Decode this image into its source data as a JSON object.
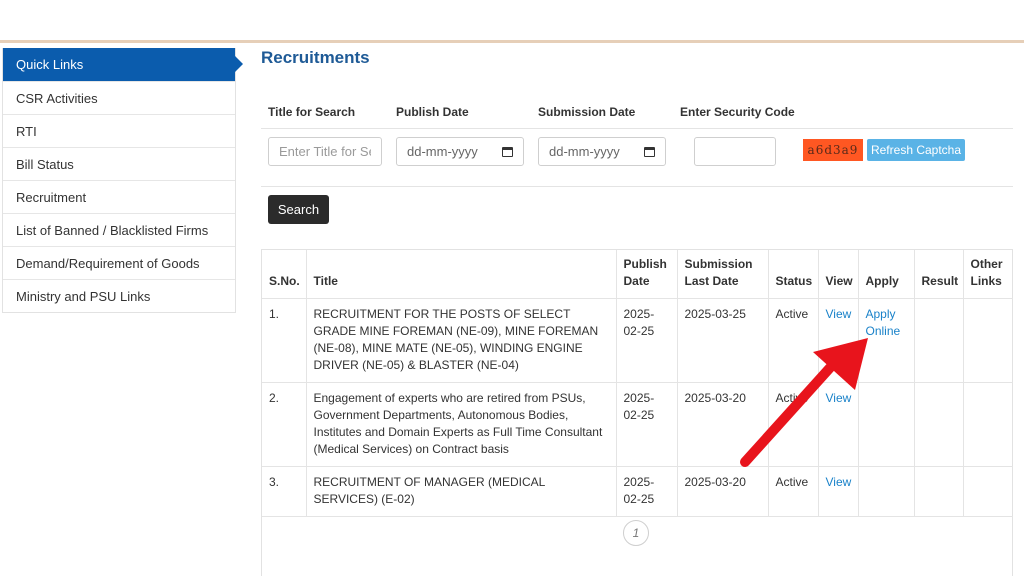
{
  "sidebar": {
    "items": [
      {
        "label": "Quick Links",
        "active": true
      },
      {
        "label": "CSR Activities"
      },
      {
        "label": "RTI"
      },
      {
        "label": "Bill Status"
      },
      {
        "label": "Recruitment"
      },
      {
        "label": "List of Banned / Blacklisted Firms"
      },
      {
        "label": "Demand/Requirement of Goods"
      },
      {
        "label": "Ministry and PSU Links"
      }
    ]
  },
  "main": {
    "title": "Recruitments",
    "form": {
      "labels": {
        "title_search": "Title for Search",
        "publish_date": "Publish Date",
        "submission_date": "Submission Date",
        "security_code": "Enter Security Code"
      },
      "title_placeholder": "Enter Title for Se",
      "publish_date_value": "dd-mm-yyyy",
      "submission_date_value": "dd-mm-yyyy",
      "captcha_text": "a6d3a9",
      "refresh_label": "Refresh Captcha",
      "search_label": "Search"
    },
    "table": {
      "headers": {
        "sno": "S.No.",
        "title": "Title",
        "publish": "Publish Date",
        "submission": "Submission Last Date",
        "status": "Status",
        "view": "View",
        "apply": "Apply",
        "result": "Result",
        "other": "Other Links"
      },
      "rows": [
        {
          "sno": "1.",
          "title": "RECRUITMENT FOR THE POSTS OF SELECT GRADE MINE FOREMAN (NE-09), MINE FOREMAN (NE-08), MINE MATE (NE-05), WINDING ENGINE DRIVER (NE-05) & BLASTER (NE-04)",
          "publish": "2025-02-25",
          "submission": "2025-03-25",
          "status": "Active",
          "view": "View",
          "apply": "Apply Online"
        },
        {
          "sno": "2.",
          "title": "Engagement of experts who are retired from PSUs, Government Departments, Autonomous Bodies, Institutes and Domain Experts as Full Time Consultant (Medical Services) on Contract basis",
          "publish": "2025-02-25",
          "submission": "2025-03-20",
          "status": "Active",
          "view": "View",
          "apply": ""
        },
        {
          "sno": "3.",
          "title": "RECRUITMENT OF MANAGER (MEDICAL SERVICES) (E-02)",
          "publish": "2025-02-25",
          "submission": "2025-03-20",
          "status": "Active",
          "view": "View",
          "apply": ""
        }
      ]
    },
    "pagination": {
      "current": "1"
    }
  },
  "colors": {
    "brand_blue": "#0b5cad",
    "title_blue": "#1e5a96",
    "link_blue": "#1a82c9",
    "captcha_bg": "#ff5722",
    "refresh_bg": "#5ab3e6",
    "annotation_red": "#e8141c"
  },
  "annotation": {
    "icon": "red-arrow-icon"
  }
}
